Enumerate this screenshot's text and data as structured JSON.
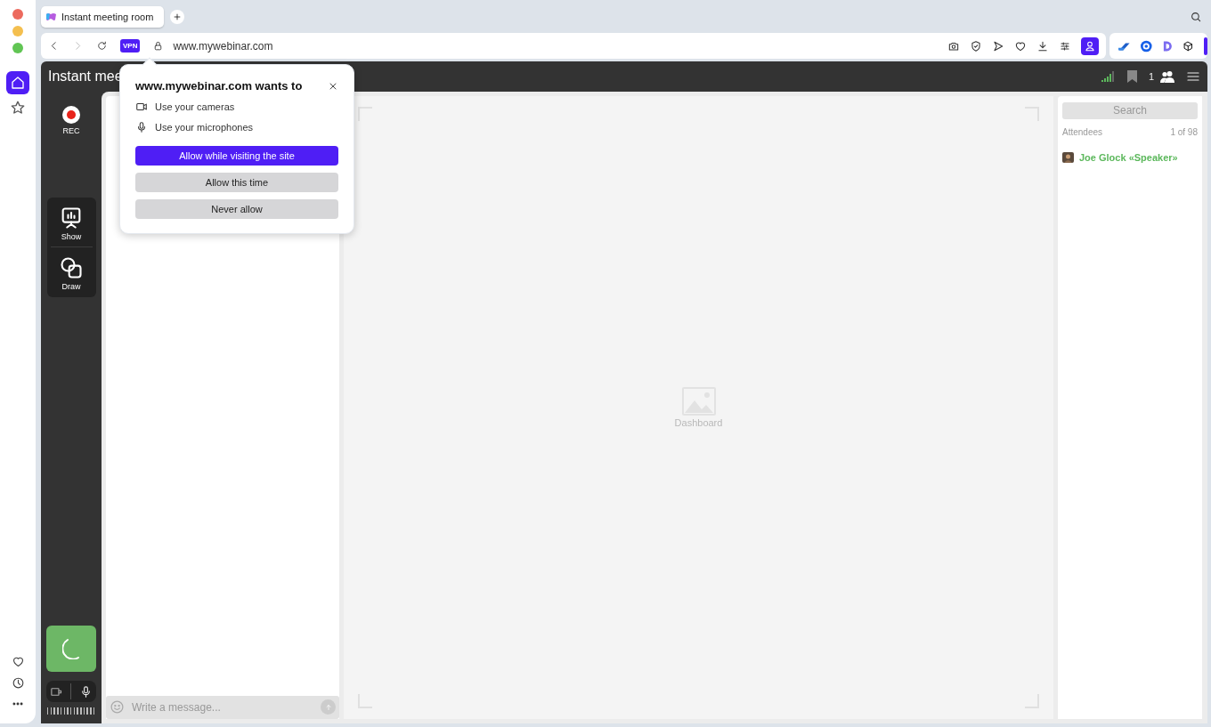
{
  "sidebar": {
    "items": [
      {
        "kind": "home",
        "selected": true
      },
      {
        "kind": "star",
        "selected": false
      }
    ]
  },
  "tab": {
    "title": "Instant meeting room",
    "selected": true
  },
  "address_bar": {
    "vpn_badge": "VPN",
    "url": "www.mywebinar.com"
  },
  "meeting": {
    "title": "Instant mee",
    "participant_count": "1",
    "rec_label": "REC",
    "tools": [
      {
        "kind": "show",
        "label": "Show"
      },
      {
        "kind": "draw",
        "label": "Draw"
      }
    ],
    "chat": {
      "placeholder": "Write a message..."
    },
    "stage": {
      "label": "Dashboard"
    },
    "attendees": {
      "search_placeholder": "Search",
      "heading": "Attendees",
      "count": "1 of 98",
      "list": [
        {
          "name": "Joe Glock «Speaker»"
        }
      ]
    }
  },
  "permission_popup": {
    "title": "www.mywebinar.com wants to",
    "permissions": [
      {
        "kind": "camera",
        "label": "Use your cameras"
      },
      {
        "kind": "microphone",
        "label": "Use your microphones"
      }
    ],
    "buttons": [
      {
        "kind": "primary",
        "label": "Allow while visiting the site"
      },
      {
        "kind": "secondary",
        "label": "Allow this time"
      },
      {
        "kind": "secondary",
        "label": "Never allow"
      }
    ]
  }
}
